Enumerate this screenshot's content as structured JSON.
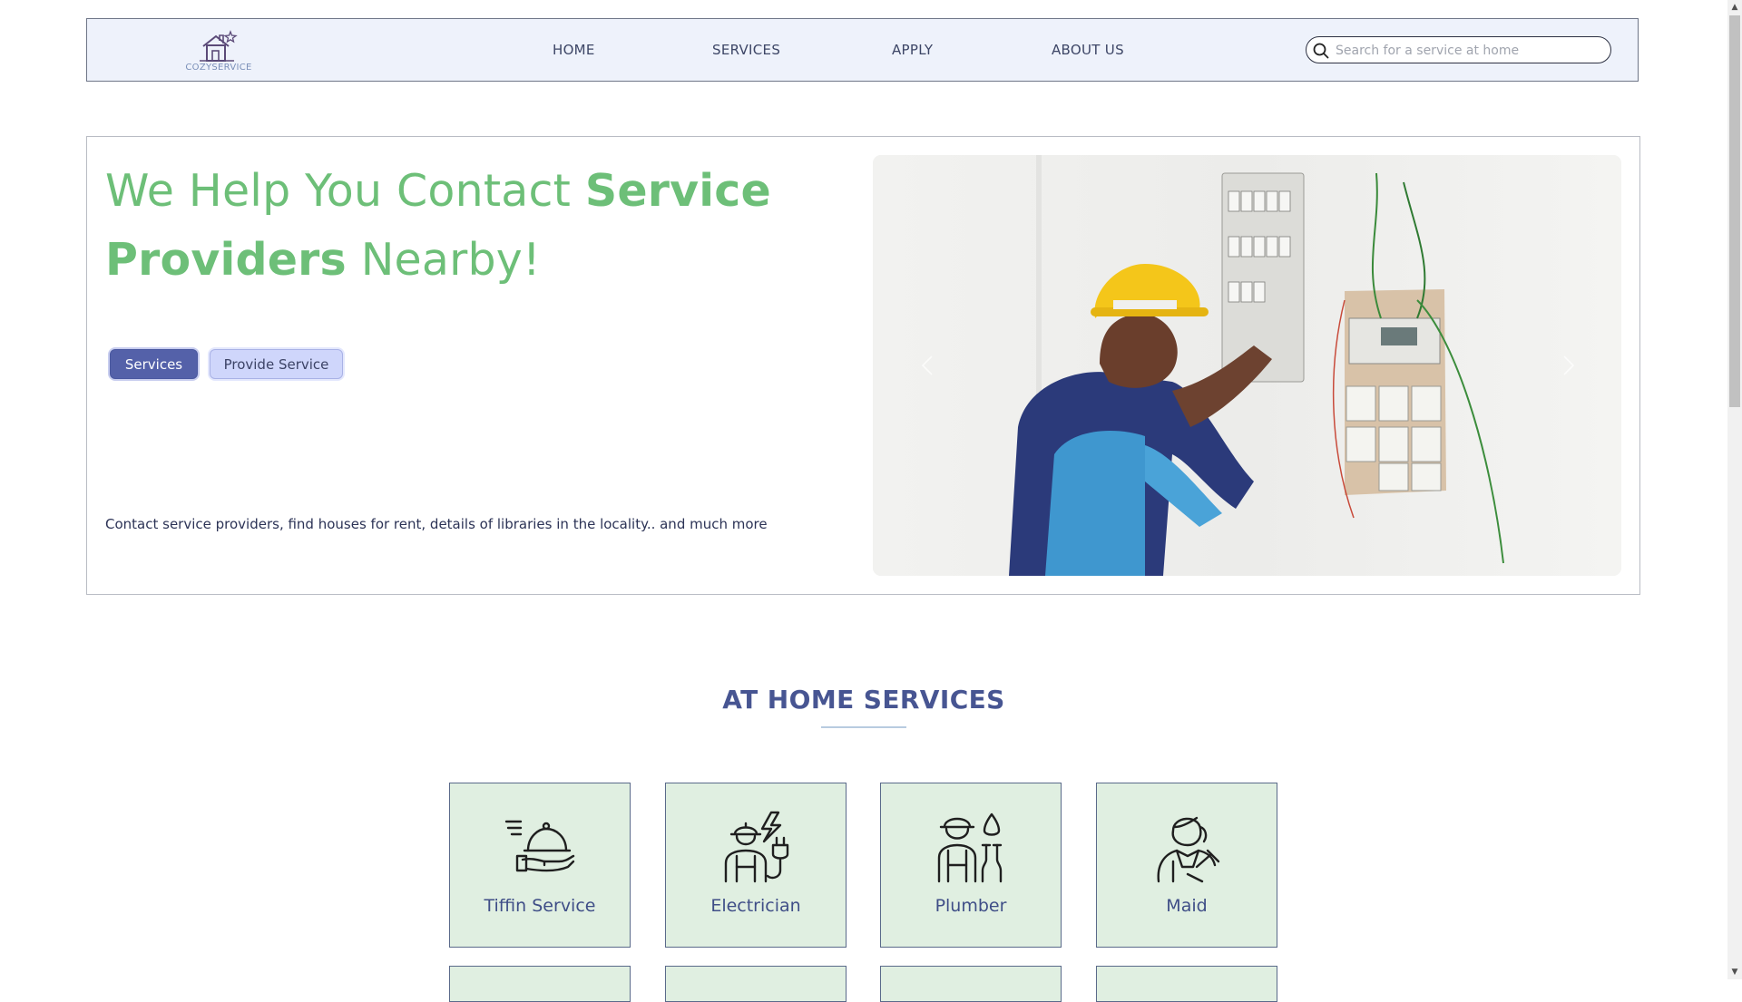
{
  "nav": {
    "logo_text": "COZYSERVICE",
    "links": [
      "HOME",
      "SERVICES",
      "APPLY",
      "ABOUT US"
    ],
    "search_placeholder": "Search for a service at home"
  },
  "hero": {
    "headline_part1": "We Help You Contact ",
    "headline_bold": "Service Providers",
    "headline_part2": " Nearby!",
    "btn_services": "Services",
    "btn_provide": "Provide Service",
    "description": "Contact service providers, find houses for rent, details of libraries in the locality.. and much more"
  },
  "section": {
    "title": "AT HOME SERVICES",
    "cards": [
      {
        "label": "Tiffin Service",
        "icon": "tiffin-icon"
      },
      {
        "label": "Electrician",
        "icon": "electrician-icon"
      },
      {
        "label": "Plumber",
        "icon": "plumber-icon"
      },
      {
        "label": "Maid",
        "icon": "maid-icon"
      }
    ]
  },
  "colors": {
    "accent_green": "#6dbf78",
    "title_blue": "#475592",
    "card_bg": "#e0efe1",
    "button_primary": "#5461a9",
    "button_secondary": "#cfd6fb"
  }
}
